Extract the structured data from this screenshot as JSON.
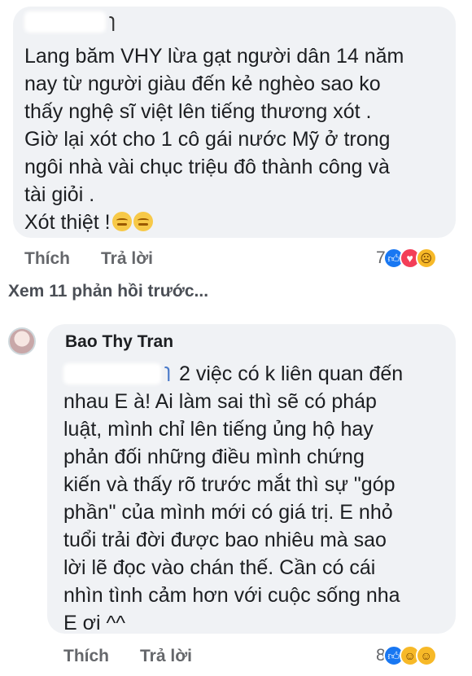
{
  "comment1": {
    "lines": [
      "Lang băm VHY lừa gạt người dân 14 năm",
      "nay từ người giàu đến kẻ nghèo sao ko",
      "thấy nghệ sĩ việt lên tiếng thương xót .",
      "Giờ lại xót cho 1 cô gái nước Mỹ ở trong",
      "ngôi nhà vài chục triệu đô thành công và",
      "tài giỏi .",
      "Xót thiệt !"
    ],
    "like_label": "Thích",
    "reply_label": "Trả lời",
    "reaction_count": "7"
  },
  "see_more_label": "Xem 11 phản hồi trước...",
  "comment2": {
    "author": "Bao Thy Tran",
    "lines": [
      "2 việc có k liên quan đến",
      "nhau E à! Ai làm sai thì sẽ có pháp",
      "luật, mình chỉ lên tiếng ủng hộ hay",
      "phản đối những điều mình chứng",
      "kiến và thấy rõ trước mắt thì sự \"góp",
      "phần\" của mình mới có giá trị. E nhỏ",
      "tuổi trải đời được bao nhiêu mà sao",
      "lời lẽ đọc vào chán thế. Cần có cái",
      "nhìn tình cảm hơn với cuộc sống nha",
      "E ơi ^^"
    ],
    "like_label": "Thích",
    "reply_label": "Trả lời",
    "reaction_count": "8"
  },
  "colors": {
    "bubble": "#f0f2f5",
    "like": "#1877f2",
    "love": "#f33e58",
    "haha": "#f7b928",
    "action_text": "#65676b"
  },
  "icons": {
    "like": "thumbs-up-icon",
    "love": "heart-icon",
    "sad": "sad-face-icon",
    "haha": "laughing-face-icon",
    "care": "care-face-icon",
    "inline": "relieved-face-emoji"
  }
}
